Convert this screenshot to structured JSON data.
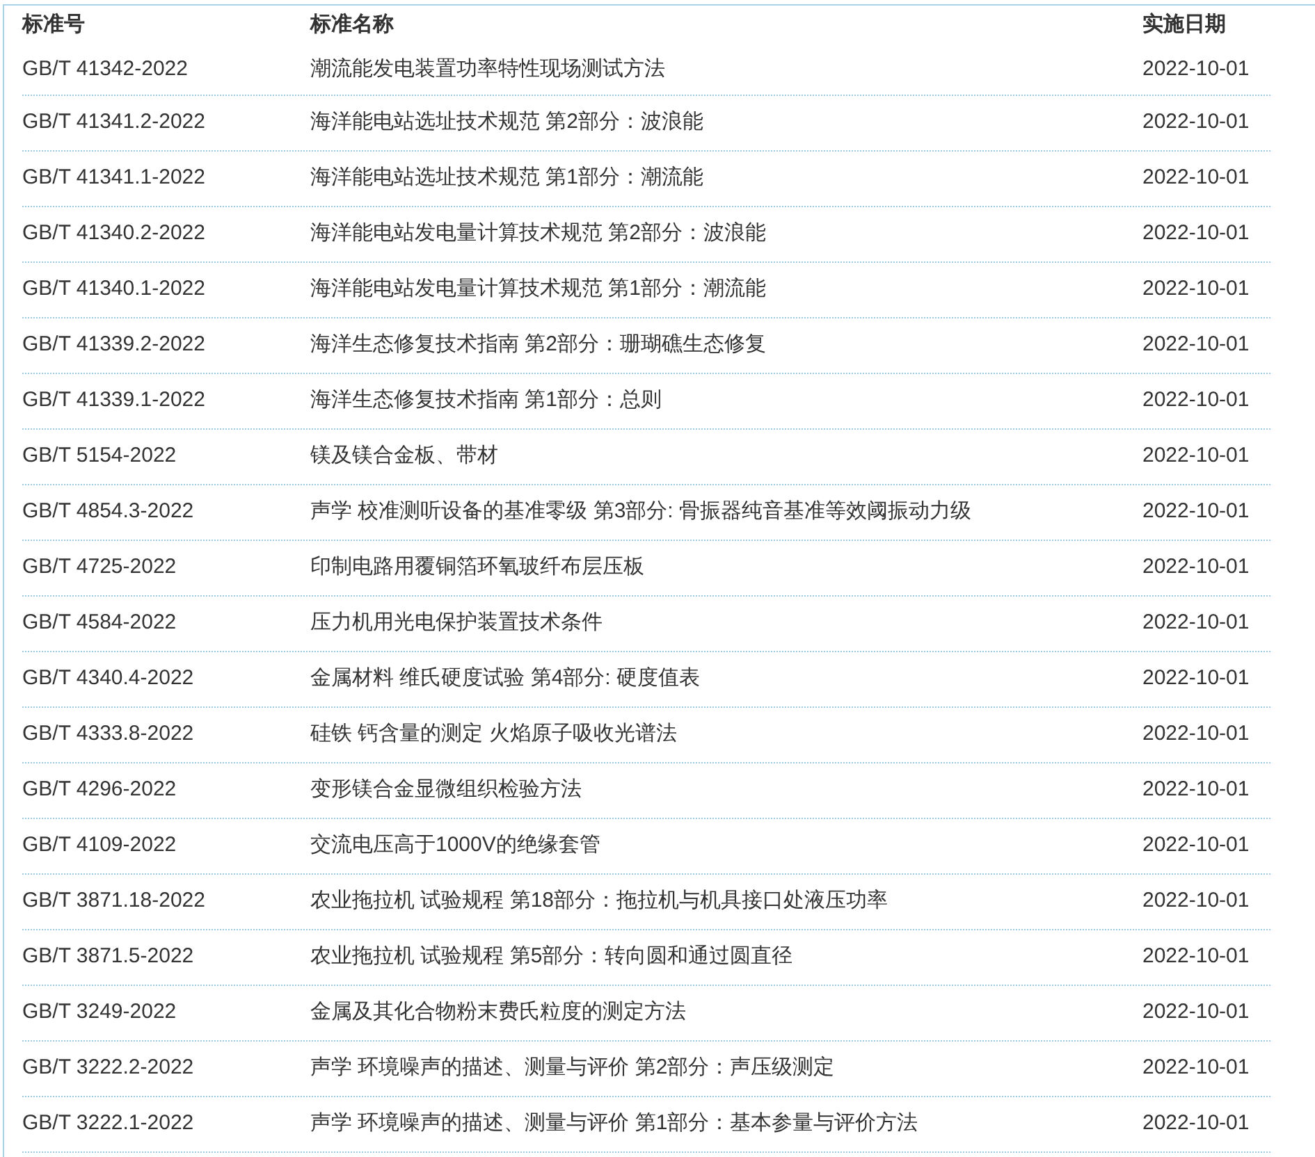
{
  "table": {
    "columns": [
      "标准号",
      "标准名称",
      "实施日期"
    ],
    "rows": [
      [
        "GB/T 41342-2022",
        "潮流能发电装置功率特性现场测试方法",
        "2022-10-01"
      ],
      [
        "GB/T 41341.2-2022",
        "海洋能电站选址技术规范 第2部分：波浪能",
        "2022-10-01"
      ],
      [
        "GB/T 41341.1-2022",
        "海洋能电站选址技术规范 第1部分：潮流能",
        "2022-10-01"
      ],
      [
        "GB/T 41340.2-2022",
        "海洋能电站发电量计算技术规范 第2部分：波浪能",
        "2022-10-01"
      ],
      [
        "GB/T 41340.1-2022",
        "海洋能电站发电量计算技术规范 第1部分：潮流能",
        "2022-10-01"
      ],
      [
        "GB/T 41339.2-2022",
        "海洋生态修复技术指南 第2部分：珊瑚礁生态修复",
        "2022-10-01"
      ],
      [
        "GB/T 41339.1-2022",
        "海洋生态修复技术指南 第1部分：总则",
        "2022-10-01"
      ],
      [
        "GB/T 5154-2022",
        "镁及镁合金板、带材",
        "2022-10-01"
      ],
      [
        "GB/T 4854.3-2022",
        "声学 校准测听设备的基准零级 第3部分: 骨振器纯音基准等效阈振动力级",
        "2022-10-01"
      ],
      [
        "GB/T 4725-2022",
        "印制电路用覆铜箔环氧玻纤布层压板",
        "2022-10-01"
      ],
      [
        "GB/T 4584-2022",
        "压力机用光电保护装置技术条件",
        "2022-10-01"
      ],
      [
        "GB/T 4340.4-2022",
        "金属材料 维氏硬度试验 第4部分: 硬度值表",
        "2022-10-01"
      ],
      [
        "GB/T 4333.8-2022",
        "硅铁 钙含量的测定 火焰原子吸收光谱法",
        "2022-10-01"
      ],
      [
        "GB/T 4296-2022",
        "变形镁合金显微组织检验方法",
        "2022-10-01"
      ],
      [
        "GB/T 4109-2022",
        "交流电压高于1000V的绝缘套管",
        "2022-10-01"
      ],
      [
        "GB/T 3871.18-2022",
        "农业拖拉机 试验规程 第18部分：拖拉机与机具接口处液压功率",
        "2022-10-01"
      ],
      [
        "GB/T 3871.5-2022",
        "农业拖拉机 试验规程 第5部分：转向圆和通过圆直径",
        "2022-10-01"
      ],
      [
        "GB/T 3249-2022",
        "金属及其化合物粉末费氏粒度的测定方法",
        "2022-10-01"
      ],
      [
        "GB/T 3222.2-2022",
        "声学 环境噪声的描述、测量与评价 第2部分：声压级测定",
        "2022-10-01"
      ],
      [
        "GB/T 3222.1-2022",
        "声学 环境噪声的描述、测量与评价 第1部分：基本参量与评价方法",
        "2022-10-01"
      ]
    ]
  }
}
